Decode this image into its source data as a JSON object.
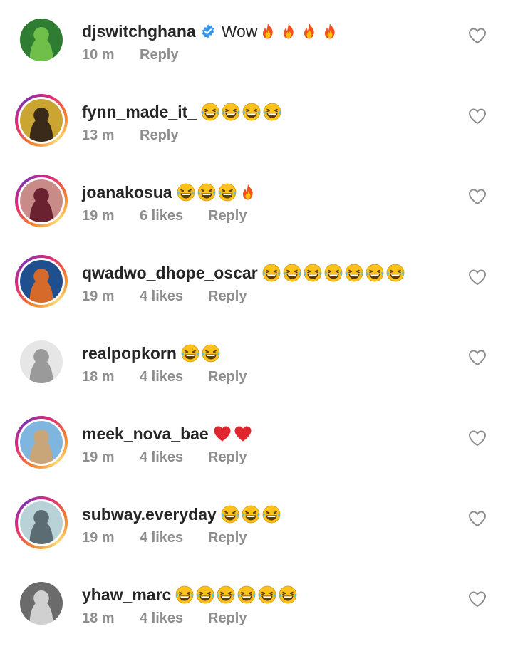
{
  "comments": [
    {
      "username": "djswitchghana",
      "verified": true,
      "text": "Wow",
      "emojis": [
        "fire",
        "fire",
        "fire",
        "fire"
      ],
      "time": "10 m",
      "likes": "",
      "reply": "Reply",
      "ring": false,
      "avatar_colors": [
        "#2e7d32",
        "#6fbf4a"
      ]
    },
    {
      "username": "fynn_made_it_",
      "verified": false,
      "text": "",
      "emojis": [
        "laugh",
        "laugh",
        "laugh",
        "laugh"
      ],
      "time": "13 m",
      "likes": "",
      "reply": "Reply",
      "ring": true,
      "avatar_colors": [
        "#caa531",
        "#3a2a1a"
      ]
    },
    {
      "username": "joanakosua",
      "verified": false,
      "text": "",
      "emojis": [
        "laugh",
        "laugh",
        "laugh",
        "fire"
      ],
      "time": "19 m",
      "likes": "6 likes",
      "reply": "Reply",
      "ring": true,
      "avatar_colors": [
        "#c98b88",
        "#6a2230"
      ]
    },
    {
      "username": "qwadwo_dhope_oscar",
      "verified": false,
      "text": "",
      "emojis": [
        "laugh",
        "laugh",
        "laugh",
        "laugh",
        "laugh",
        "laugh",
        "laugh"
      ],
      "time": "19 m",
      "likes": "4 likes",
      "reply": "Reply",
      "ring": true,
      "avatar_colors": [
        "#1f4f8f",
        "#d56a2a"
      ]
    },
    {
      "username": "realpopkorn",
      "verified": false,
      "text": "",
      "emojis": [
        "laugh",
        "laugh"
      ],
      "time": "18 m",
      "likes": "4 likes",
      "reply": "Reply",
      "ring": false,
      "avatar_colors": [
        "#e6e6e6",
        "#9a9a9a"
      ]
    },
    {
      "username": "meek_nova_bae",
      "verified": false,
      "text": "",
      "emojis": [
        "heart",
        "heart"
      ],
      "time": "19 m",
      "likes": "4 likes",
      "reply": "Reply",
      "ring": true,
      "avatar_colors": [
        "#7fb6e0",
        "#c9a57a"
      ]
    },
    {
      "username": "subway.everyday",
      "verified": false,
      "text": "",
      "emojis": [
        "laugh",
        "laugh",
        "laugh"
      ],
      "time": "19 m",
      "likes": "4 likes",
      "reply": "Reply",
      "ring": true,
      "avatar_colors": [
        "#b9d2d8",
        "#5b6d73"
      ]
    },
    {
      "username": "yhaw_marc",
      "verified": false,
      "text": "",
      "emojis": [
        "laugh",
        "laugh",
        "laugh",
        "laugh",
        "laugh",
        "laugh"
      ],
      "time": "18 m",
      "likes": "4 likes",
      "reply": "Reply",
      "ring": false,
      "avatar_colors": [
        "#6b6b6b",
        "#d0d0d0"
      ]
    }
  ],
  "icons": {
    "like": "heart-outline-icon",
    "verified": "verified-badge-icon"
  },
  "colors": {
    "text": "#262626",
    "meta": "#8e8e8e",
    "verified": "#3897f0",
    "ring_start": "#f58529",
    "ring_mid": "#dd2a7b"
  }
}
